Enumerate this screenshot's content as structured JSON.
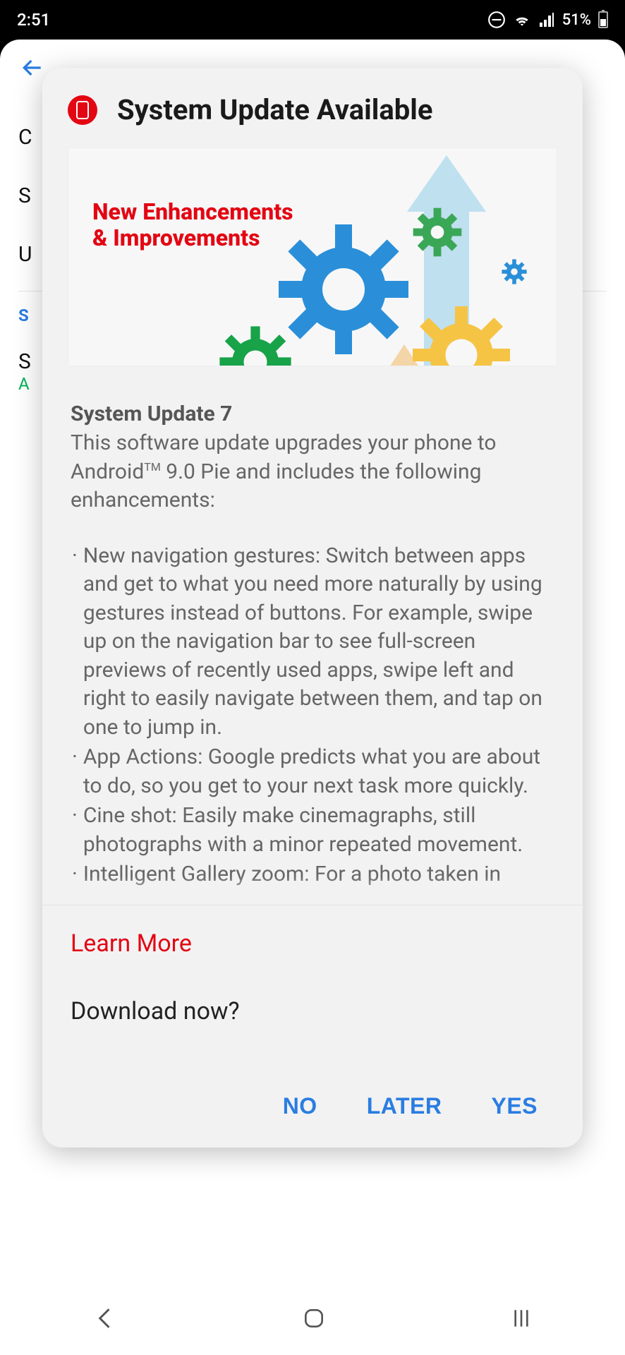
{
  "status": {
    "time": "2:51",
    "batteryPct": "51%"
  },
  "bg": {
    "rows": [
      "C",
      "S",
      "U"
    ],
    "sectionInitial": "S",
    "itemInitial": "S",
    "subInitial": "A"
  },
  "dialog": {
    "title": "System Update Available",
    "banner": {
      "line1": "New Enhancements",
      "line2": "& Improvements"
    },
    "updateName": "System Update 7",
    "descPrefix": "This software update upgrades your phone to Android",
    "tm": "TM",
    "descSuffix": " 9.0 Pie and includes the following enhancements:",
    "bullets": [
      "New navigation gestures: Switch between apps and get to what you need more naturally by using gestures instead of buttons. For example, swipe up on the navigation bar to see full-screen previews of recently used apps, swipe left and right to easily navigate between them, and tap on one to jump in.",
      "App Actions: Google predicts what you are about to do, so you get to your next task more quickly.",
      "Cine shot: Easily make cinemagraphs, still photographs with a minor repeated movement.",
      "Intelligent Gallery zoom: For a photo taken in"
    ],
    "learnMore": "Learn More",
    "downloadPrompt": "Download now?",
    "buttons": {
      "no": "NO",
      "later": "LATER",
      "yes": "YES"
    }
  }
}
